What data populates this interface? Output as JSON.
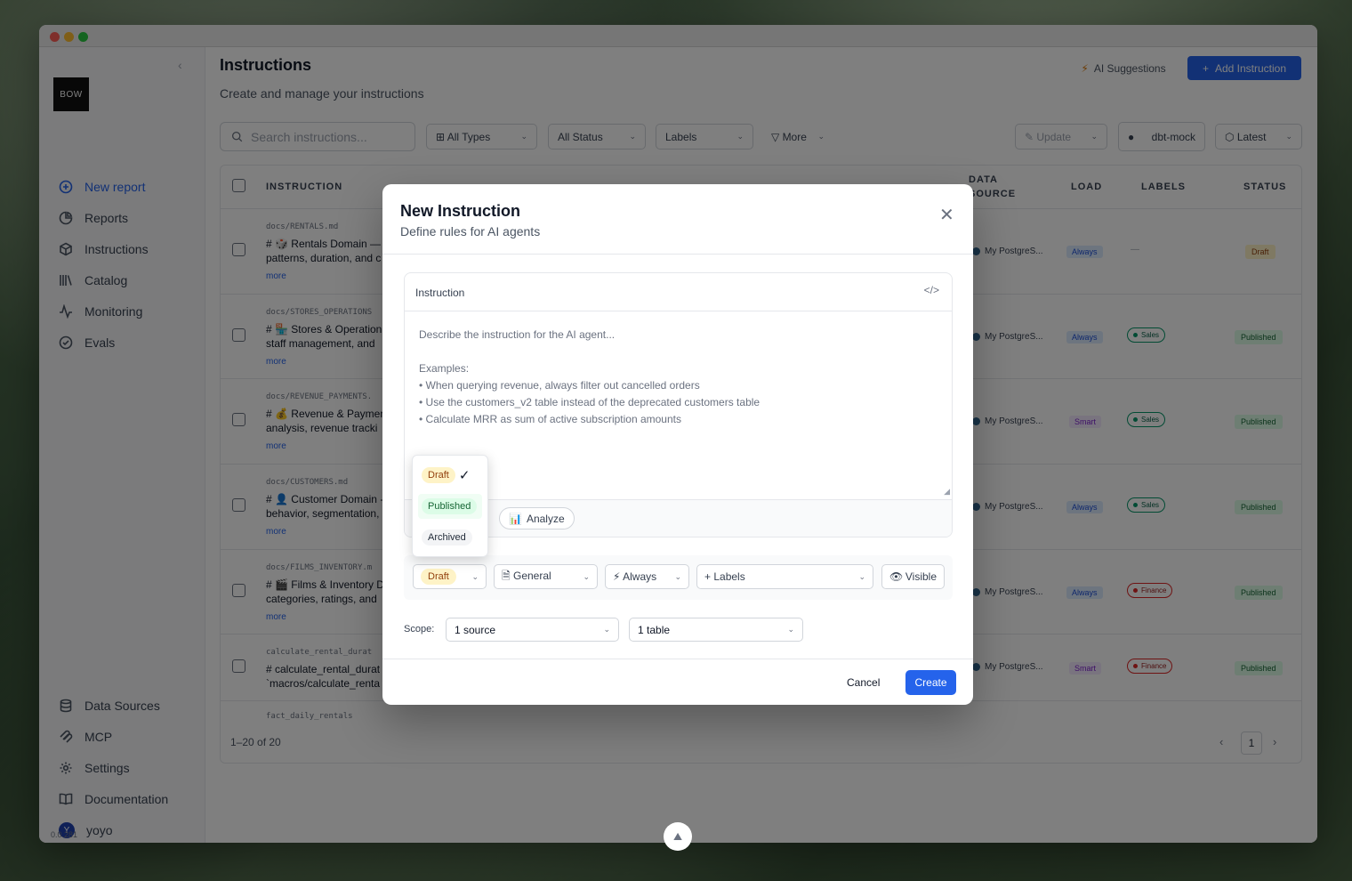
{
  "sidebar": {
    "logo": "BOW",
    "items": [
      {
        "label": "New report",
        "icon": "plus-circle-icon"
      },
      {
        "label": "Reports",
        "icon": "pie-chart-icon"
      },
      {
        "label": "Instructions",
        "icon": "cube-icon"
      },
      {
        "label": "Catalog",
        "icon": "library-icon"
      },
      {
        "label": "Monitoring",
        "icon": "activity-icon"
      },
      {
        "label": "Evals",
        "icon": "check-circle-icon"
      }
    ],
    "bottom_items": [
      {
        "label": "Data Sources",
        "icon": "database-icon"
      },
      {
        "label": "MCP",
        "icon": "mcp-icon"
      },
      {
        "label": "Settings",
        "icon": "gear-icon"
      },
      {
        "label": "Documentation",
        "icon": "book-icon"
      }
    ],
    "user": {
      "initial": "Y",
      "name": "yoyo"
    },
    "version": "0.0.281"
  },
  "header": {
    "title": "Instructions",
    "subtitle": "Create and manage your instructions",
    "ai_suggestions": "AI Suggestions",
    "add_instruction": "Add Instruction"
  },
  "filters": {
    "search_placeholder": "Search instructions...",
    "all_types": "All Types",
    "all_status": "All Status",
    "labels": "Labels",
    "more": "More",
    "update": "Update",
    "repo": "dbt-mock",
    "version": "Latest"
  },
  "table": {
    "columns": [
      "INSTRUCTION",
      "DATA",
      "SOURCE",
      "LOAD",
      "LABELS",
      "STATUS"
    ],
    "rows": [
      {
        "path": "docs/RENTALS.md",
        "line1": "# 🎲 Rentals Domain — R",
        "line2": "patterns, duration, and c",
        "more": "more",
        "source": "My PostgreS...",
        "load": "Always",
        "load_type": "always",
        "label": "—",
        "label_type": "",
        "status": "Draft"
      },
      {
        "path": "docs/STORES_OPERATIONS",
        "line1": "# 🏪 Stores & Operation",
        "line2": "staff management, and",
        "more": "more",
        "source": "My PostgreS...",
        "load": "Always",
        "load_type": "always",
        "label": "Sales",
        "label_type": "sales",
        "status": "Published"
      },
      {
        "path": "docs/REVENUE_PAYMENTS.",
        "line1": "# 💰 Revenue & Paymen",
        "line2": "analysis, revenue tracki",
        "more": "more",
        "source": "My PostgreS...",
        "load": "Smart",
        "load_type": "smart",
        "label": "Sales",
        "label_type": "sales",
        "status": "Published"
      },
      {
        "path": "docs/CUSTOMERS.md",
        "line1": "# 👤 Customer Domain -",
        "line2": "behavior, segmentation,",
        "more": "more",
        "source": "My PostgreS...",
        "load": "Always",
        "load_type": "always",
        "label": "Sales",
        "label_type": "sales",
        "status": "Published"
      },
      {
        "path": "docs/FILMS_INVENTORY.m",
        "line1": "# 🎬 Films & Inventory D",
        "line2": "categories, ratings, and",
        "more": "more",
        "source": "My PostgreS...",
        "load": "Always",
        "load_type": "always",
        "label": "Finance",
        "label_type": "finance",
        "status": "Published"
      },
      {
        "path": "calculate_rental_durat",
        "line1": "# calculate_rental_durat",
        "line2": "`macros/calculate_renta",
        "more": "",
        "source": "My PostgreS...",
        "load": "Smart",
        "load_type": "smart",
        "label": "Finance",
        "label_type": "finance",
        "status": "Published"
      },
      {
        "path": "fact_daily_rentals",
        "line1": "",
        "line2": "",
        "more": "",
        "source": "",
        "load": "",
        "load_type": "",
        "label": "",
        "label_type": "",
        "status": ""
      }
    ],
    "pager_text": "1–20 of 20",
    "page": "1"
  },
  "modal": {
    "title": "New Instruction",
    "subtitle": "Define rules for AI agents",
    "editor_label": "Instruction",
    "placeholder": "Describe the instruction for the AI agent...\n\nExamples:\n• When querying revenue, always filter out cancelled orders\n• Use the customers_v2 table instead of the deprecated customers table\n• Calculate MRR as sum of active subscription amounts",
    "analyze": "Analyze",
    "status_value": "Draft",
    "category": "General",
    "load": "Always",
    "labels": "+ Labels",
    "visibility": "Visible",
    "scope_label": "Scope:",
    "scope_source": "1 source",
    "scope_table": "1 table",
    "cancel": "Cancel",
    "create": "Create"
  },
  "status_dropdown": {
    "options": [
      "Draft",
      "Published",
      "Archived"
    ],
    "selected": "Draft"
  },
  "colors": {
    "accent": "#2563eb",
    "draft_bg": "#fef3c7",
    "published_bg": "#dcfce7"
  }
}
